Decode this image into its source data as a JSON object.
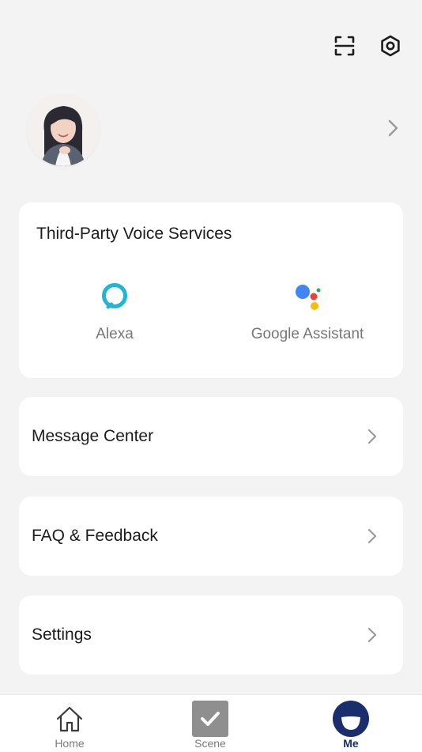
{
  "profile": {
    "avatar_alt": "user avatar"
  },
  "voice_services": {
    "title": "Third-Party Voice Services",
    "items": [
      {
        "label": "Alexa",
        "icon": "alexa-icon"
      },
      {
        "label": "Google Assistant",
        "icon": "google-assistant-icon"
      }
    ]
  },
  "menu": {
    "message_center": "Message Center",
    "faq_feedback": "FAQ & Feedback",
    "settings": "Settings"
  },
  "tabbar": {
    "items": [
      {
        "label": "Home",
        "icon": "home-icon"
      },
      {
        "label": "Scene",
        "icon": "scene-check-icon"
      },
      {
        "label": "Me",
        "icon": "me-icon",
        "active": true
      }
    ]
  },
  "colors": {
    "background": "#f3f3f3",
    "card": "#ffffff",
    "alexa": "#1fb6d6",
    "active_tab": "#1a2e6e"
  }
}
